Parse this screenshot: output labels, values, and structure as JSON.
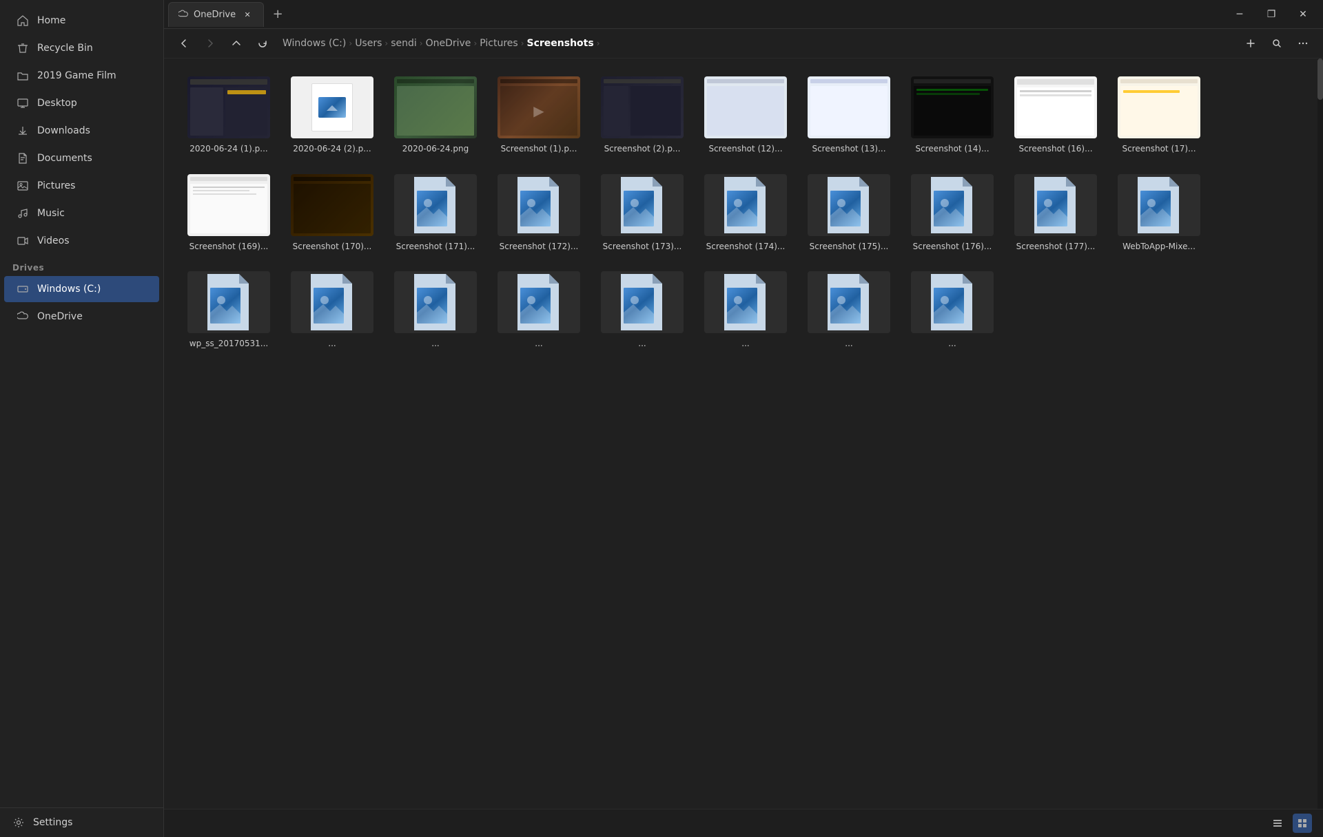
{
  "window": {
    "title": "OneDrive",
    "tab_label": "OneDrive",
    "tab_icon": "cloud-icon",
    "min_label": "─",
    "max_label": "❐",
    "close_label": "✕",
    "add_tab_label": "+"
  },
  "breadcrumb": {
    "items": [
      {
        "label": "Windows (C:)",
        "key": "windows-c"
      },
      {
        "label": "Users",
        "key": "users"
      },
      {
        "label": "sendi",
        "key": "sendi"
      },
      {
        "label": "OneDrive",
        "key": "onedrive"
      },
      {
        "label": "Pictures",
        "key": "pictures"
      },
      {
        "label": "Screenshots",
        "key": "screenshots",
        "active": true
      }
    ],
    "sep": "›"
  },
  "toolbar": {
    "back": "←",
    "forward": "→",
    "up": "↑",
    "refresh": "↺",
    "new": "+",
    "search": "🔍",
    "more": "···"
  },
  "sidebar": {
    "items": [
      {
        "label": "Home",
        "icon": "home-icon",
        "key": "home"
      },
      {
        "label": "Recycle Bin",
        "icon": "recyclebin-icon",
        "key": "recycle-bin"
      },
      {
        "label": "2019 Game Film",
        "icon": "folder-icon",
        "key": "game-film"
      },
      {
        "label": "Desktop",
        "icon": "desktop-icon",
        "key": "desktop"
      },
      {
        "label": "Downloads",
        "icon": "download-icon",
        "key": "downloads"
      },
      {
        "label": "Documents",
        "icon": "document-icon",
        "key": "documents"
      },
      {
        "label": "Pictures",
        "icon": "pictures-icon",
        "key": "pictures"
      },
      {
        "label": "Music",
        "icon": "music-icon",
        "key": "music"
      },
      {
        "label": "Videos",
        "icon": "video-icon",
        "key": "videos"
      }
    ],
    "drives_section": "Drives",
    "drives": [
      {
        "label": "Windows (C:)",
        "icon": "drive-icon",
        "key": "windows-c",
        "active": true
      },
      {
        "label": "OneDrive",
        "icon": "cloud-icon",
        "key": "onedrive"
      }
    ],
    "settings_label": "Settings",
    "settings_icon": "gear-icon"
  },
  "files": [
    {
      "name": "2020-06-24 (1).p...",
      "type": "screenshot-dark",
      "row": 1
    },
    {
      "name": "2020-06-24 (2).p...",
      "type": "screenshot-white",
      "row": 1
    },
    {
      "name": "2020-06-24.png",
      "type": "screenshot-map",
      "row": 1
    },
    {
      "name": "Screenshot (1).p...",
      "type": "screenshot-brown",
      "row": 1
    },
    {
      "name": "Screenshot (2).p...",
      "type": "screenshot-dark2",
      "row": 1
    },
    {
      "name": "Screenshot (12)...",
      "type": "screenshot-light",
      "row": 1
    },
    {
      "name": "Screenshot (13)...",
      "type": "screenshot-light2",
      "row": 1
    },
    {
      "name": "Screenshot (14)...",
      "type": "screenshot-console",
      "row": 2
    },
    {
      "name": "Screenshot (16)...",
      "type": "screenshot-browser",
      "row": 2
    },
    {
      "name": "Screenshot (17)...",
      "type": "screenshot-yellow",
      "row": 2
    },
    {
      "name": "Screenshot (169)...",
      "type": "screenshot-email",
      "row": 2
    },
    {
      "name": "Screenshot (170)...",
      "type": "screenshot-amber",
      "row": 2
    },
    {
      "name": "Screenshot (171)...",
      "type": "generic-image",
      "row": 2
    },
    {
      "name": "Screenshot (172)...",
      "type": "generic-image",
      "row": 2
    },
    {
      "name": "Screenshot (173)...",
      "type": "generic-image",
      "row": 3
    },
    {
      "name": "Screenshot (174)...",
      "type": "generic-image",
      "row": 3
    },
    {
      "name": "Screenshot (175)...",
      "type": "generic-image",
      "row": 3
    },
    {
      "name": "Screenshot (176)...",
      "type": "generic-image",
      "row": 3
    },
    {
      "name": "Screenshot (177)...",
      "type": "generic-image",
      "row": 3
    },
    {
      "name": "WebToApp-Mixe...",
      "type": "generic-image",
      "row": 3
    },
    {
      "name": "wp_ss_20170531...",
      "type": "generic-image",
      "row": 3
    },
    {
      "name": "...",
      "type": "generic-image",
      "row": 4
    },
    {
      "name": "...",
      "type": "generic-image",
      "row": 4
    },
    {
      "name": "...",
      "type": "generic-image",
      "row": 4
    },
    {
      "name": "...",
      "type": "generic-image",
      "row": 4
    },
    {
      "name": "...",
      "type": "generic-image",
      "row": 4
    },
    {
      "name": "...",
      "type": "generic-image",
      "row": 4
    },
    {
      "name": "...",
      "type": "generic-image",
      "row": 4
    }
  ],
  "status": {
    "list_view_label": "≡",
    "grid_view_label": "⊞"
  }
}
